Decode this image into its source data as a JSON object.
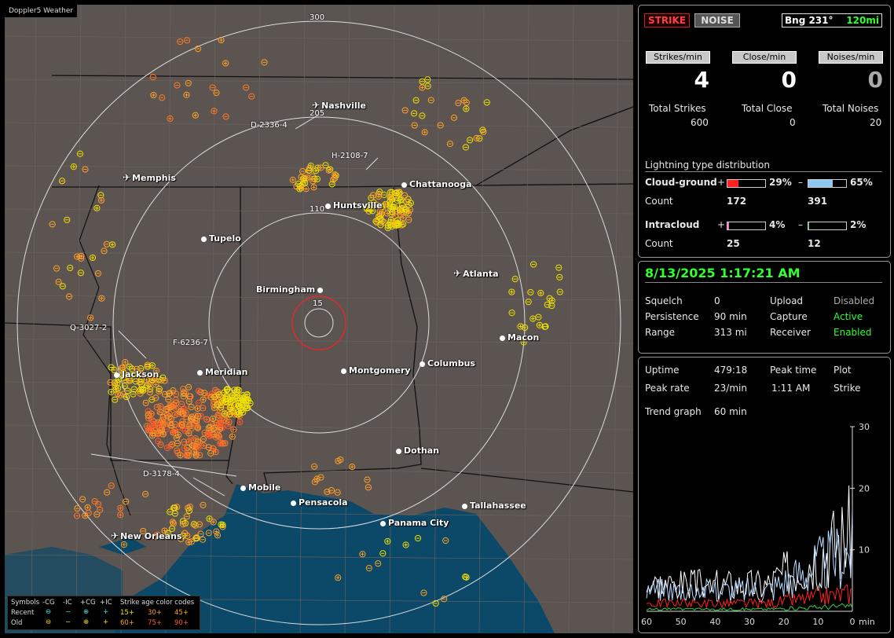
{
  "app": {
    "title": "Doppler5 Weather"
  },
  "colors": {
    "ring": "#ffffff",
    "strike": "#ff2020",
    "ic_bar": "#ff70c0",
    "cg_neg": "#8cc8f0",
    "ic_neg": "#40d060",
    "accent_green": "#30ff30",
    "water": "#0c4868",
    "land": "#5b5450"
  },
  "map": {
    "range_labels": [
      "300",
      "205",
      "110",
      "15"
    ],
    "cities": [
      {
        "name": "Nashville",
        "marker": "airport"
      },
      {
        "name": "Memphis",
        "marker": "airport"
      },
      {
        "name": "Chattanooga",
        "marker": "dot"
      },
      {
        "name": "Huntsville",
        "marker": "dot"
      },
      {
        "name": "Tupelo",
        "marker": "dot"
      },
      {
        "name": "Atlanta",
        "marker": "airport"
      },
      {
        "name": "Birmingham",
        "marker": "dot"
      },
      {
        "name": "Macon",
        "marker": "dot"
      },
      {
        "name": "Jackson",
        "marker": "dot"
      },
      {
        "name": "Meridian",
        "marker": "dot"
      },
      {
        "name": "Montgomery",
        "marker": "dot"
      },
      {
        "name": "Columbus",
        "marker": "dot"
      },
      {
        "name": "Dothan",
        "marker": "dot"
      },
      {
        "name": "Mobile",
        "marker": "dot"
      },
      {
        "name": "Pensacola",
        "marker": "dot"
      },
      {
        "name": "Tallahassee",
        "marker": "dot"
      },
      {
        "name": "Panama City",
        "marker": "dot"
      },
      {
        "name": "New Orleans",
        "marker": "airport"
      }
    ],
    "track_labels": [
      "D-2336-4",
      "H-2108-7",
      "Q-3027-2",
      "F-6236-7",
      "D-3178-4"
    ]
  },
  "legend": {
    "header": [
      "Symbols",
      "-CG",
      "-IC",
      "+CG",
      "+IC"
    ],
    "age_title": "Strike age color codes",
    "recent_label": "Recent",
    "old_label": "Old",
    "recent_ages": [
      "15+",
      "30+",
      "45+"
    ],
    "old_ages": [
      "60+",
      "75+",
      "90+"
    ]
  },
  "status": {
    "strike_btn": "STRIKE",
    "noise_btn": "NOISE",
    "bearing": "Bng 231°",
    "distance": "120mi"
  },
  "rates": {
    "strikes_label": "Strikes/min",
    "strikes_value": "4",
    "close_label": "Close/min",
    "close_value": "0",
    "noises_label": "Noises/min",
    "noises_value": "0"
  },
  "totals": {
    "strikes_label": "Total Strikes",
    "strikes": "600",
    "close_label": "Total Close",
    "close": "0",
    "noises_label": "Total Noises",
    "noises": "20"
  },
  "distribution": {
    "title": "Lightning type distribution",
    "cg_label": "Cloud-ground",
    "ic_label": "Intracloud",
    "count_label": "Count",
    "plus": "+",
    "minus": "–",
    "cg_pos_pct": "29%",
    "cg_pos_frac": 0.29,
    "cg_pos_count": "172",
    "cg_neg_pct": "65%",
    "cg_neg_frac": 0.65,
    "cg_neg_count": "391",
    "ic_pos_pct": "4%",
    "ic_pos_frac": 0.04,
    "ic_pos_count": "25",
    "ic_neg_pct": "2%",
    "ic_neg_frac": 0.02,
    "ic_neg_count": "12"
  },
  "system": {
    "datetime": "8/13/2025 1:17:21 AM",
    "squelch_label": "Squelch",
    "squelch": "0",
    "persistence_label": "Persistence",
    "persistence": "90 min",
    "range_label": "Range",
    "range": "313 mi",
    "upload_label": "Upload",
    "upload": "Disabled",
    "capture_label": "Capture",
    "capture": "Active",
    "receiver_label": "Receiver",
    "receiver": "Enabled"
  },
  "trend": {
    "uptime_label": "Uptime",
    "uptime": "479:18",
    "peak_time_label": "Peak time",
    "peak_time": "1:11 AM",
    "plot_label": "Plot",
    "plot": "Strike",
    "peak_rate_label": "Peak rate",
    "peak_rate": "23/min",
    "graph_label": "Trend graph",
    "graph": "60 min",
    "y_ticks": [
      "30",
      "20",
      "10"
    ],
    "x_ticks": [
      "60",
      "50",
      "40",
      "30",
      "20",
      "10",
      "0"
    ],
    "x_unit": "min"
  }
}
